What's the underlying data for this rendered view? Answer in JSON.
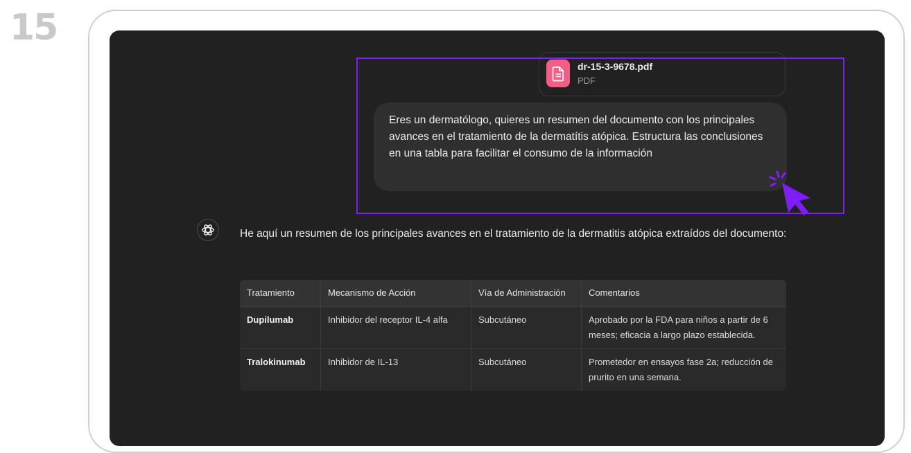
{
  "step": "15",
  "file": {
    "name": "dr-15-3-9678.pdf",
    "type": "PDF"
  },
  "user_message": "Eres un dermatólogo, quieres un resumen del documento con los principales avances en el tratamiento de la dermatítis atópica. Estructura las conclusiones en una tabla para facilitar el consumo de la información",
  "assistant": {
    "intro": "He aquí un resumen de los principales avances en el tratamiento de la dermatitis atópica extraídos del documento:",
    "table": {
      "headers": [
        "Tratamiento",
        "Mecanismo de Acción",
        "Vía de Administración",
        "Comentarios"
      ],
      "rows": [
        [
          "Dupilumab",
          "Inhibidor del receptor IL-4 alfa",
          "Subcutáneo",
          "Aprobado por la FDA para niños a partir de 6 meses; eficacia a largo plazo establecida."
        ],
        [
          "Tralokinumab",
          "Inhibidor de IL-13",
          "Subcutáneo",
          "Prometedor en ensayos fase 2a; reducción de prurito en una semana."
        ]
      ]
    }
  },
  "icons": {
    "file": "document-icon",
    "cursor": "click-cursor-icon",
    "avatar": "openai-logo-icon"
  },
  "colors": {
    "highlight": "#7c1ef5",
    "file_icon_bg": "#f55e84",
    "screen_bg": "#212121"
  }
}
